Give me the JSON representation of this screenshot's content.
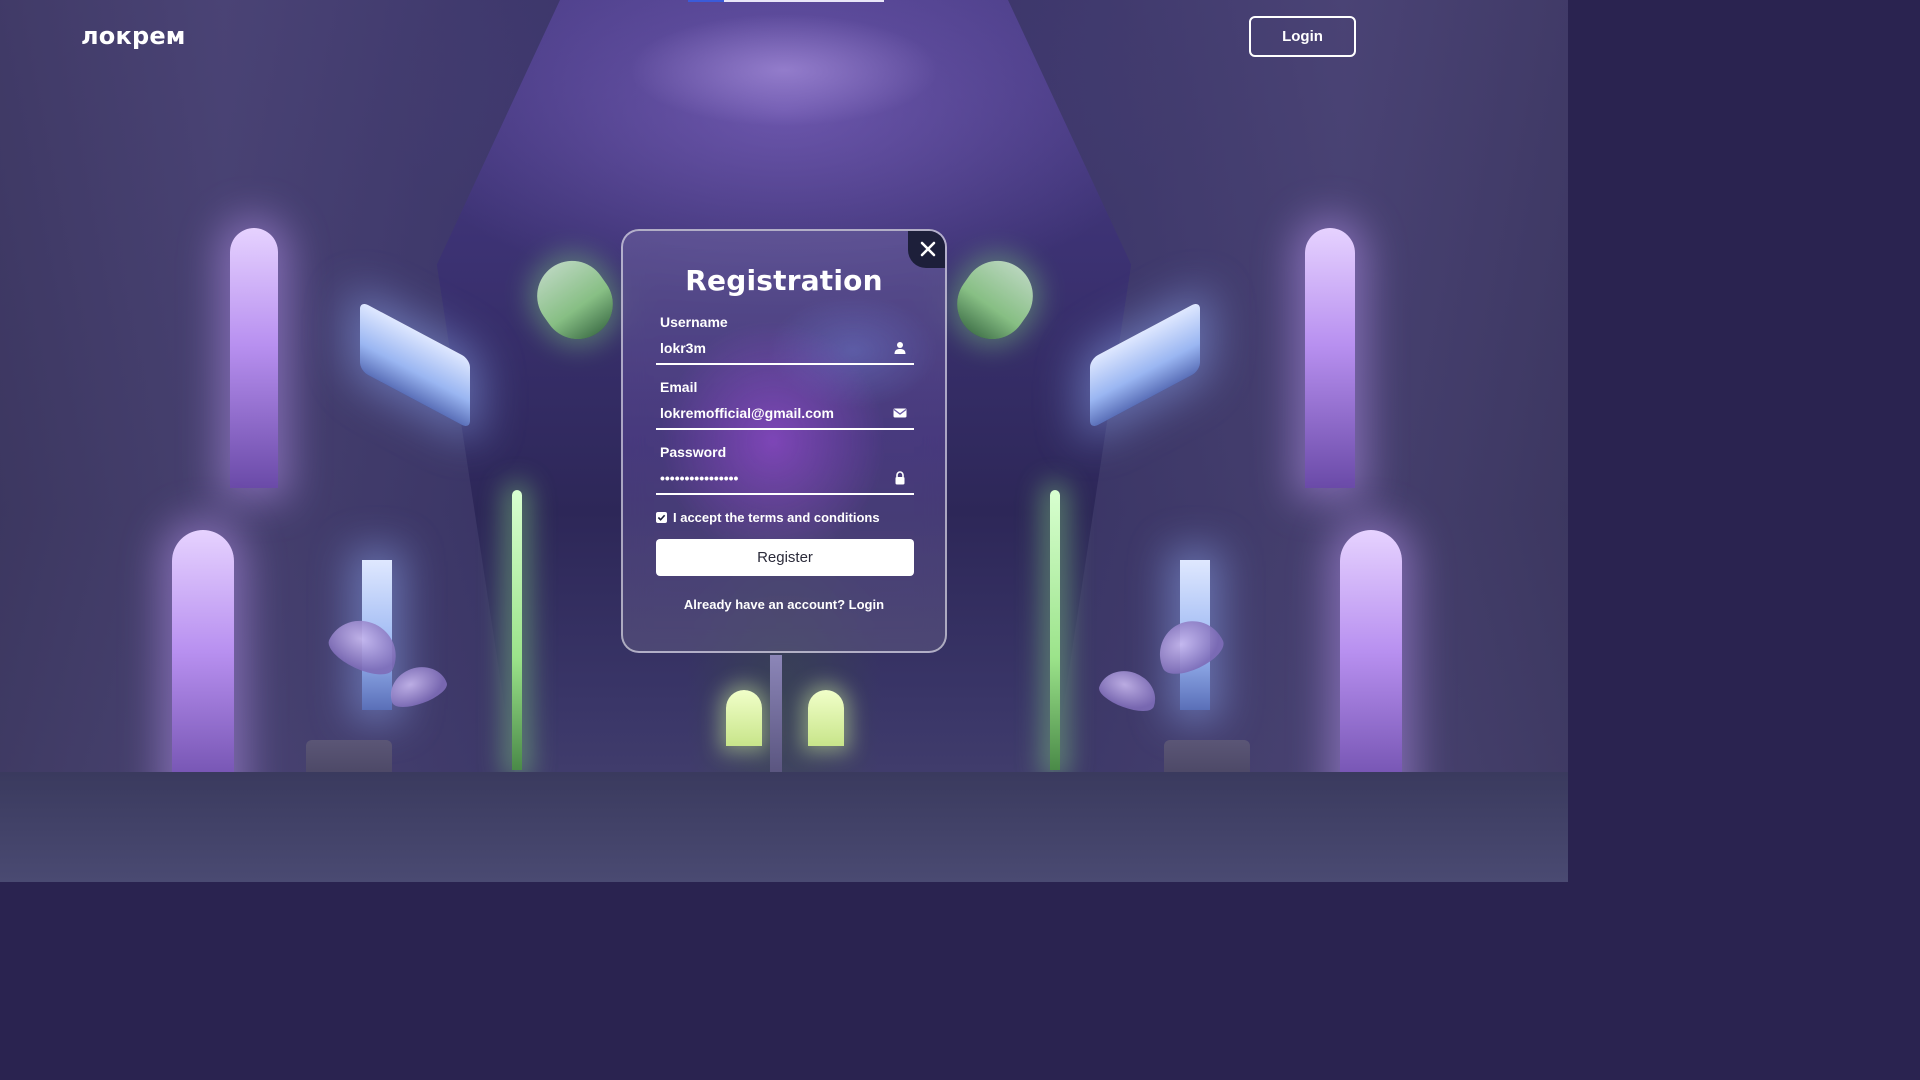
{
  "header": {
    "brand": "локрем",
    "login_label": "Login"
  },
  "modal": {
    "title": "Registration",
    "username": {
      "label": "Username",
      "value": "lokr3m",
      "icon": "user-icon"
    },
    "email": {
      "label": "Email",
      "value": "lokremofficial@gmail.com",
      "icon": "mail-icon"
    },
    "password": {
      "label": "Password",
      "value": "••••••••••••••••",
      "icon": "lock-icon"
    },
    "terms_label": "I accept the terms and conditions",
    "terms_checked": true,
    "register_label": "Register",
    "switch_prompt": "Already have an account?",
    "switch_link": "Login",
    "close_icon": "close-icon"
  },
  "colors": {
    "accent_dark": "#1d1f3a",
    "text": "#ffffff"
  }
}
